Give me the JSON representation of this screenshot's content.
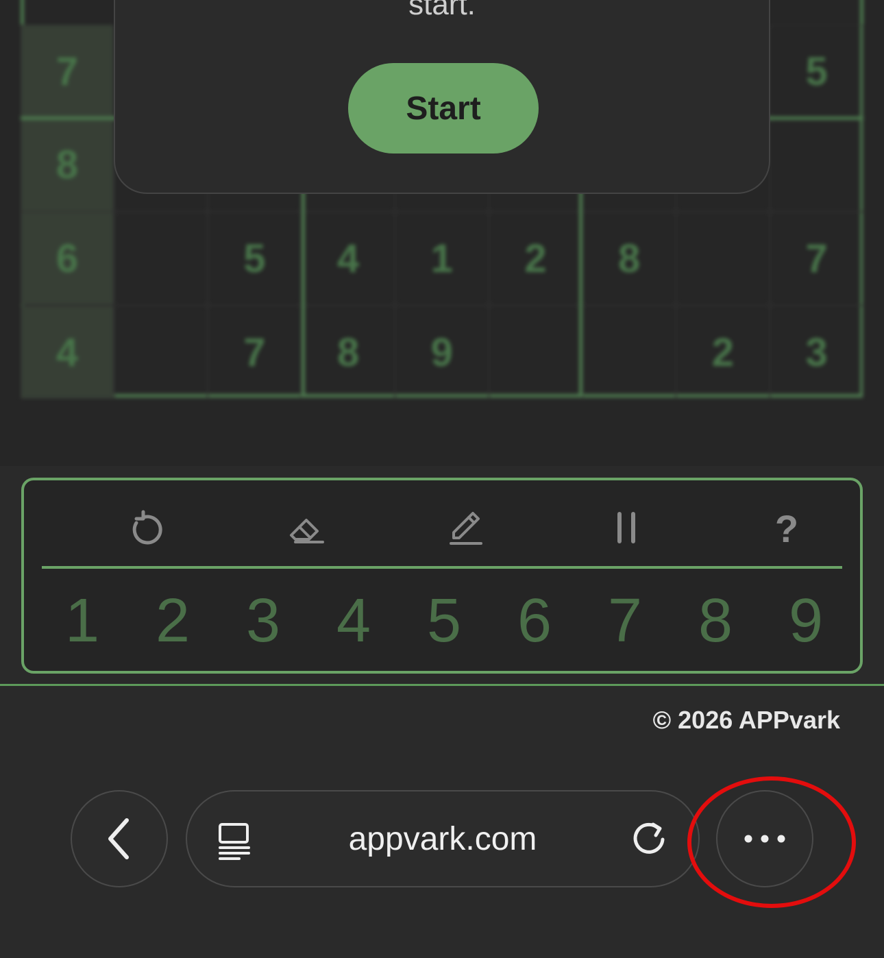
{
  "board": {
    "rows": [
      [
        "7",
        "",
        "",
        "",
        "",
        "",
        "",
        "",
        "5"
      ],
      [
        "8",
        "",
        "",
        "",
        "",
        "",
        "",
        "",
        ""
      ],
      [
        "6",
        "",
        "5",
        "4",
        "1",
        "2",
        "8",
        "",
        "7"
      ],
      [
        "4",
        "",
        "7",
        "8",
        "9",
        "",
        "",
        "2",
        "3"
      ]
    ]
  },
  "modal": {
    "text": "start.",
    "start_label": "Start"
  },
  "tools": {
    "undo_icon": "undo-icon",
    "erase_icon": "eraser-icon",
    "notes_icon": "pencil-icon",
    "pause_icon": "pause-icon",
    "hint_label": "?"
  },
  "numbers": [
    "1",
    "2",
    "3",
    "4",
    "5",
    "6",
    "7",
    "8",
    "9"
  ],
  "footer": {
    "copyright": "© 2026 APPvark"
  },
  "browser": {
    "url": "appvark.com",
    "more_label": "•••"
  },
  "colors": {
    "accent": "#6aa366",
    "annotation": "#e30d0d"
  }
}
